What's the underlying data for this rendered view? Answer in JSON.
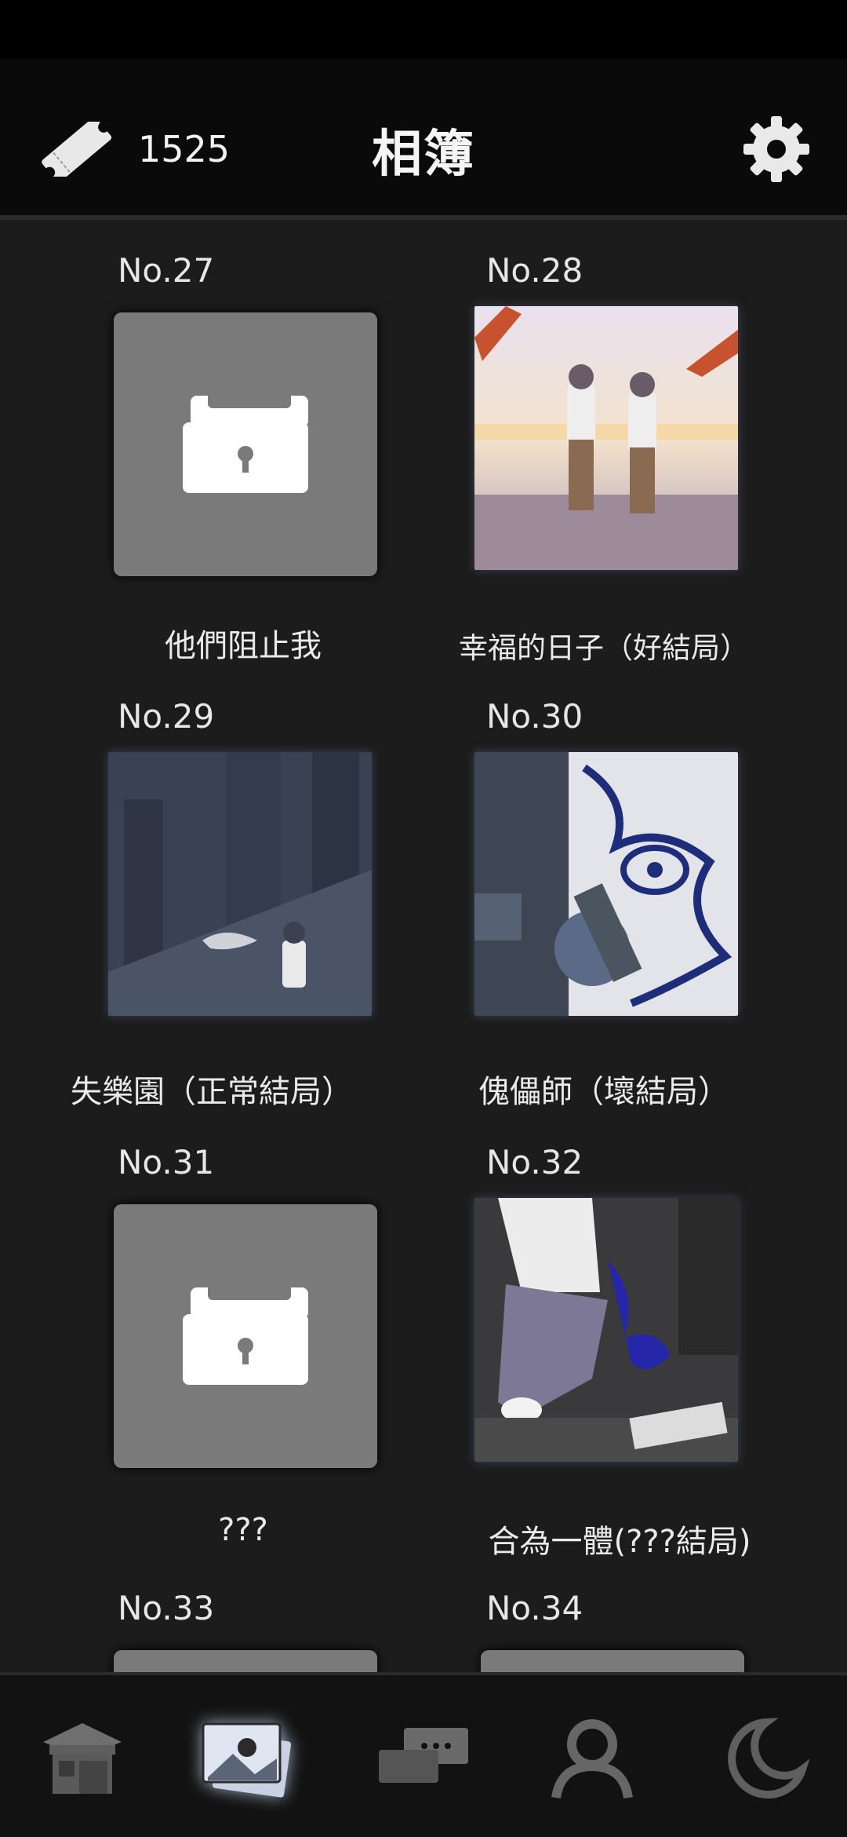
{
  "header": {
    "ticket_count": "1525",
    "title": "相簿"
  },
  "album": [
    {
      "no": "No.27",
      "caption": "他們阻止我",
      "locked": true
    },
    {
      "no": "No.28",
      "caption": "幸福的日子（好結局）",
      "locked": false
    },
    {
      "no": "No.29",
      "caption": "失樂園（正常結局）",
      "locked": false
    },
    {
      "no": "No.30",
      "caption": "傀儡師（壞結局）",
      "locked": false
    },
    {
      "no": "No.31",
      "caption": "???",
      "locked": true
    },
    {
      "no": "No.32",
      "caption": "合為一體(???結局)",
      "locked": false
    },
    {
      "no": "No.33",
      "caption": "",
      "locked": true
    },
    {
      "no": "No.34",
      "caption": "",
      "locked": true
    }
  ],
  "nav": [
    {
      "name": "shop",
      "icon": "shop-icon",
      "active": false
    },
    {
      "name": "album",
      "icon": "album-icon",
      "active": true
    },
    {
      "name": "messages",
      "icon": "chat-icon",
      "active": false
    },
    {
      "name": "characters",
      "icon": "person-icon",
      "active": false
    },
    {
      "name": "night",
      "icon": "moon-icon",
      "active": false
    }
  ]
}
